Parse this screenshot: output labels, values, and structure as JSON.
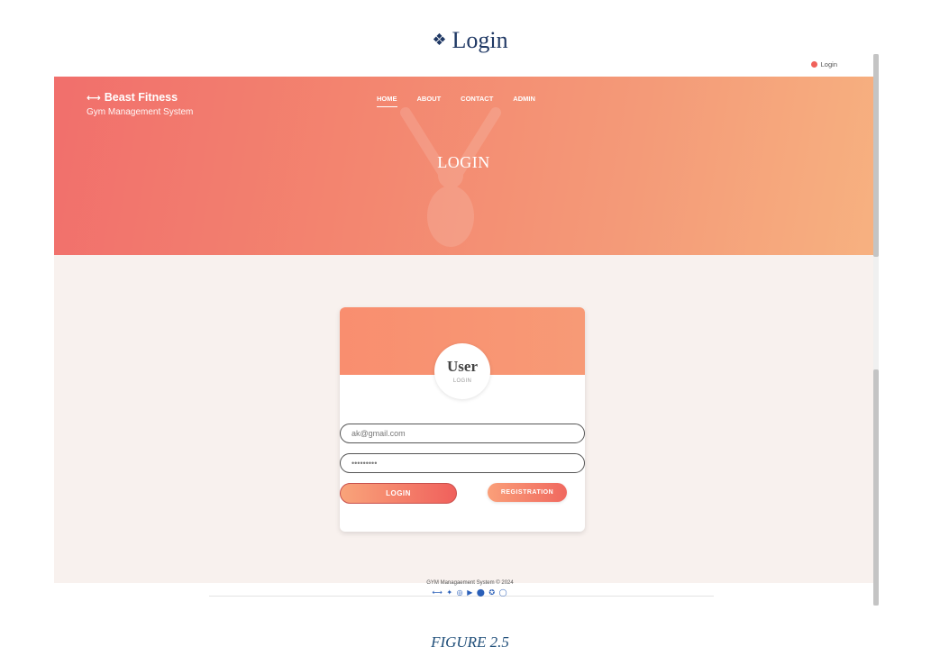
{
  "document": {
    "heading_glyph": "❖",
    "heading": "Login",
    "caption": "FIGURE 2.5"
  },
  "topbar": {
    "login_label": "Login"
  },
  "header": {
    "brand_icon": "⟷",
    "brand_name": "Beast Fitness",
    "brand_subtitle": "Gym Management System",
    "nav": [
      {
        "label": "HOME",
        "active": true
      },
      {
        "label": "ABOUT",
        "active": false
      },
      {
        "label": "CONTACT",
        "active": false
      },
      {
        "label": "ADMIN",
        "active": false
      }
    ],
    "hero_title": "LOGIN"
  },
  "login_card": {
    "title": "User",
    "subtitle": "LOGIN",
    "email_value": "ak@gmail.com",
    "password_value": "•••••••••",
    "login_button": "LOGIN",
    "registration_button": "REGISTRATION"
  },
  "footer": {
    "text": "GYM Managaement System © 2024",
    "social_icons_text": "⟷ ✦ ◎ ▶ ⬤ ✪ ◯"
  },
  "colors": {
    "hero_start": "#f16f6c",
    "hero_end": "#f7b180",
    "content_bg": "#f8f1ee",
    "heading": "#1f3864",
    "caption": "#1f4e79"
  }
}
